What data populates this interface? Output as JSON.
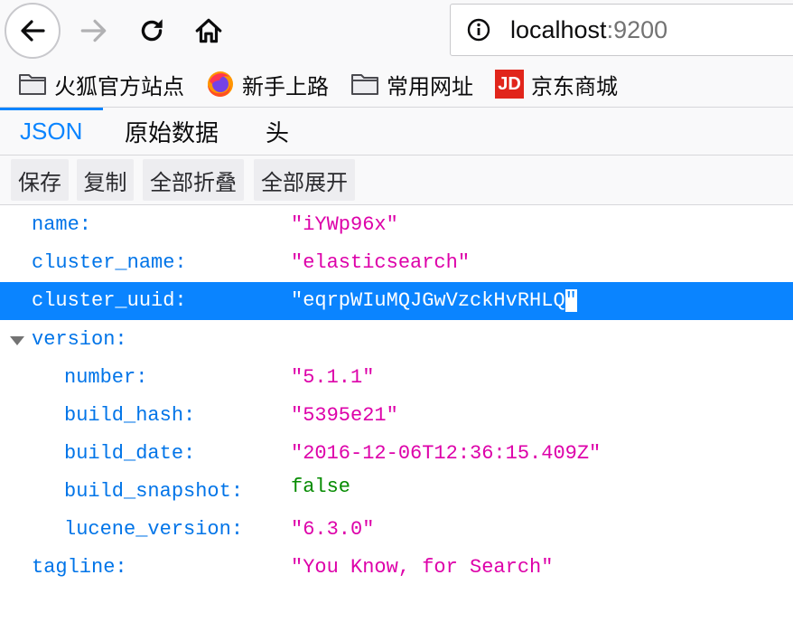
{
  "browser": {
    "url_host": "localhost",
    "url_port": ":9200",
    "bookmarks": [
      {
        "label": "火狐官方站点",
        "icon": "folder-icon"
      },
      {
        "label": "新手上路",
        "icon": "firefox-icon"
      },
      {
        "label": "常用网址",
        "icon": "folder-icon"
      },
      {
        "label": "京东商城",
        "icon": "jd-logo-icon",
        "icon_text": "JD"
      }
    ]
  },
  "viewer": {
    "tabs": [
      "JSON",
      "原始数据",
      "头"
    ],
    "active_tab": "JSON",
    "actions": [
      "保存",
      "复制",
      "全部折叠",
      "全部展开"
    ]
  },
  "json": {
    "name": {
      "key": "name:",
      "value": "\"iYWp96x\""
    },
    "cluster_name": {
      "key": "cluster_name:",
      "value": "\"elasticsearch\""
    },
    "cluster_uuid": {
      "key": "cluster_uuid:",
      "value_main": "\"eqrpWIuMQJGwVzckHvRHLQ",
      "value_end": "\""
    },
    "version": {
      "key": "version:",
      "number": {
        "key": "number:",
        "value": "\"5.1.1\""
      },
      "build_hash": {
        "key": "build_hash:",
        "value": "\"5395e21\""
      },
      "build_date": {
        "key": "build_date:",
        "value": "\"2016-12-06T12:36:15.409Z\""
      },
      "build_snapshot": {
        "key": "build_snapshot:",
        "value": "false"
      },
      "lucene_version": {
        "key": "lucene_version:",
        "value": "\"6.3.0\""
      }
    },
    "tagline": {
      "key": "tagline:",
      "value": "\"You Know, for Search\""
    }
  },
  "colors": {
    "accent": "#0a84ff",
    "key": "#0074e8",
    "string": "#dd00a9",
    "boolean": "#058b00",
    "jd_red": "#e1251b"
  }
}
